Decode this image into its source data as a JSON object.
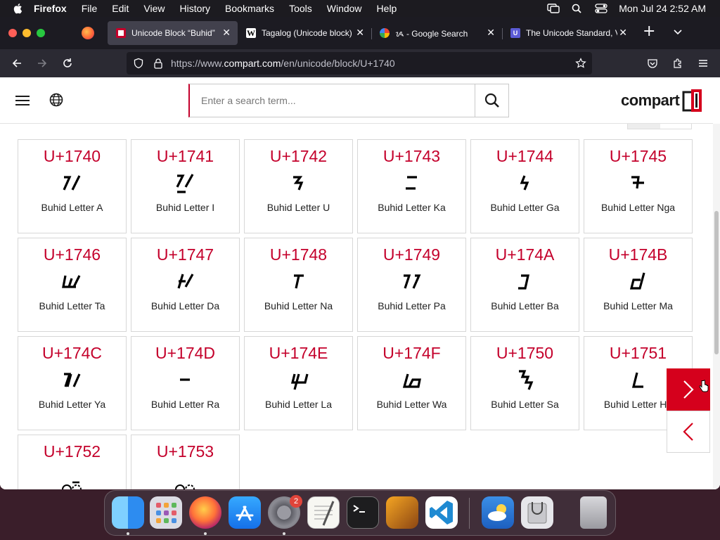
{
  "menubar": {
    "app": "Firefox",
    "items": [
      "File",
      "Edit",
      "View",
      "History",
      "Bookmarks",
      "Tools",
      "Window",
      "Help"
    ],
    "clock": "Mon Jul 24  2:52 AM"
  },
  "tabs": [
    {
      "title": "Unicode Block “Buhid”",
      "favicon": "compart-favicon",
      "color": "#c4002b"
    },
    {
      "title": "Tagalog (Unicode block)",
      "favicon": "wikipedia-favicon",
      "color": "#ffffff"
    },
    {
      "title": "ᝰ - Google Search",
      "favicon": "google-favicon",
      "color": "#4285f4"
    },
    {
      "title": "The Unicode Standard, V",
      "favicon": "unicode-favicon",
      "color": "#5b5bd6"
    }
  ],
  "address": {
    "prefix": "https://www.",
    "domain": "compart.com",
    "path": "/en/unicode/block/U+1740"
  },
  "site": {
    "search_placeholder": "Enter a search term...",
    "logo_text": "compart",
    "accent_color": "#c4002b"
  },
  "characters": [
    {
      "code": "U+1740",
      "name": "Buhid Letter A",
      "glyph": "a"
    },
    {
      "code": "U+1741",
      "name": "Buhid Letter I",
      "glyph": "i"
    },
    {
      "code": "U+1742",
      "name": "Buhid Letter U",
      "glyph": "u"
    },
    {
      "code": "U+1743",
      "name": "Buhid Letter Ka",
      "glyph": "ka"
    },
    {
      "code": "U+1744",
      "name": "Buhid Letter Ga",
      "glyph": "ga"
    },
    {
      "code": "U+1745",
      "name": "Buhid Letter Nga",
      "glyph": "nga"
    },
    {
      "code": "U+1746",
      "name": "Buhid Letter Ta",
      "glyph": "ta"
    },
    {
      "code": "U+1747",
      "name": "Buhid Letter Da",
      "glyph": "da"
    },
    {
      "code": "U+1748",
      "name": "Buhid Letter Na",
      "glyph": "na"
    },
    {
      "code": "U+1749",
      "name": "Buhid Letter Pa",
      "glyph": "pa"
    },
    {
      "code": "U+174A",
      "name": "Buhid Letter Ba",
      "glyph": "ba"
    },
    {
      "code": "U+174B",
      "name": "Buhid Letter Ma",
      "glyph": "ma"
    },
    {
      "code": "U+174C",
      "name": "Buhid Letter Ya",
      "glyph": "ya"
    },
    {
      "code": "U+174D",
      "name": "Buhid Letter Ra",
      "glyph": "ra"
    },
    {
      "code": "U+174E",
      "name": "Buhid Letter La",
      "glyph": "la"
    },
    {
      "code": "U+174F",
      "name": "Buhid Letter Wa",
      "glyph": "wa"
    },
    {
      "code": "U+1750",
      "name": "Buhid Letter Sa",
      "glyph": "sa"
    },
    {
      "code": "U+1751",
      "name": "Buhid Letter Ha",
      "glyph": "ha"
    },
    {
      "code": "U+1752",
      "name": "",
      "glyph": "vi"
    },
    {
      "code": "U+1753",
      "name": "",
      "glyph": "vu"
    }
  ],
  "dock": {
    "apps": [
      "Finder",
      "Launchpad",
      "Firefox",
      "App Store",
      "System Settings",
      "TextEdit",
      "Terminal",
      "GarageBand",
      "Visual Studio Code",
      "Weather",
      "Disk Utility",
      "Trash"
    ],
    "settings_badge": "2"
  }
}
